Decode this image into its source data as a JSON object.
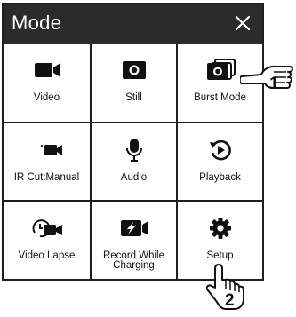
{
  "dialog": {
    "title": "Mode",
    "close_icon": "close-icon"
  },
  "modes": [
    {
      "label": "Video",
      "icon": "video-camera-icon"
    },
    {
      "label": "Still",
      "icon": "camera-still-icon"
    },
    {
      "label": "Burst Mode",
      "icon": "burst-mode-icon"
    },
    {
      "label": "IR Cut:Manual",
      "icon": "ir-cut-icon"
    },
    {
      "label": "Audio",
      "icon": "microphone-icon"
    },
    {
      "label": "Playback",
      "icon": "playback-icon"
    },
    {
      "label": "Video Lapse",
      "icon": "video-lapse-icon"
    },
    {
      "label": "Record While Charging",
      "icon": "record-charging-icon"
    },
    {
      "label": "Setup",
      "icon": "gear-icon"
    }
  ],
  "callouts": [
    "1",
    "2"
  ],
  "colors": {
    "header": "#2b2b2b",
    "border": "#1e1e1e",
    "icon": "#111111"
  }
}
